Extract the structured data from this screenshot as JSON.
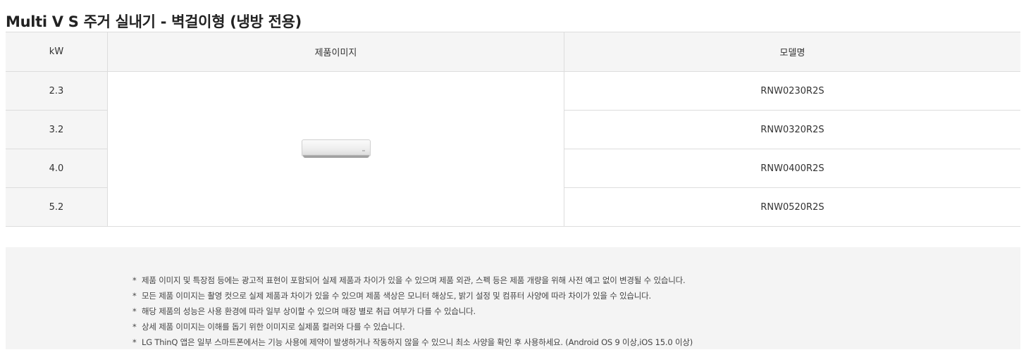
{
  "page": {
    "title": "Multi V S 주거 실내기 - 벽걸이형 (냉방 전용)"
  },
  "table": {
    "headers": {
      "kw": "kW",
      "image": "제품이미지",
      "model": "모델명"
    },
    "rows": [
      {
        "kw": "2.3",
        "model": "RNW0230R2S"
      },
      {
        "kw": "3.2",
        "model": "RNW0320R2S"
      },
      {
        "kw": "4.0",
        "model": "RNW0400R2S"
      },
      {
        "kw": "5.2",
        "model": "RNW0520R2S"
      }
    ],
    "product_image": "wall-mounted-air-conditioner"
  },
  "notices": {
    "bullet": "*",
    "items": [
      "제품 이미지 및 특장점 등에는 광고적 표현이 포함되어 실제 제품과 차이가 있을 수 있으며 제품 외관, 스펙 등은 제품 개량을 위해 사전 예고 없이 변경될 수 있습니다.",
      "모든 제품 이미지는 촬영 컷으로 실제 제품과 차이가 있을 수 있으며 제품 색상은 모니터 해상도, 밝기 설정 및 컴퓨터 사양에 따라 차이가 있을 수 있습니다.",
      "해당 제품의 성능은 사용 환경에 따라 일부 상이할 수 있으며 매장 별로 취급 여부가 다를 수 있습니다.",
      "상세 제품 이미지는 이해를 돕기 위한 이미지로 실제품 컬러와 다를 수 있습니다.",
      "LG ThinQ 앱은 일부 스마트폰에서는 기능 사용에 제약이 발생하거나 작동하지 않을 수 있으니 최소 사양을 확인 후 사용하세요. (Android OS 9 이상,iOS 15.0 이상)"
    ]
  },
  "colors": {
    "header_bg": "#f5f5f5",
    "border": "#dddddd",
    "notice_bg": "#f4f4f4",
    "text": "#333333"
  }
}
